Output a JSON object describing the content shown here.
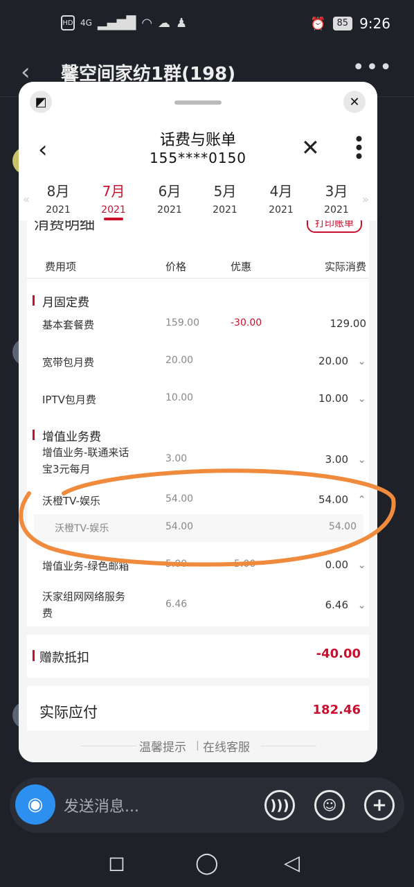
{
  "status_bar": {
    "left_icons": [
      "HD",
      "4G"
    ],
    "battery": "85",
    "time": "9:26"
  },
  "chat": {
    "title": "馨空间家纺1群(198)",
    "input_placeholder": "发送消息..."
  },
  "page": {
    "title": "话费与账单",
    "phone": "155****0150",
    "months": [
      {
        "month": "8月",
        "year": "2021",
        "active": false
      },
      {
        "month": "7月",
        "year": "2021",
        "active": true
      },
      {
        "month": "6月",
        "year": "2021",
        "active": false
      },
      {
        "month": "5月",
        "year": "2021",
        "active": false
      },
      {
        "month": "4月",
        "year": "2021",
        "active": false
      },
      {
        "month": "3月",
        "year": "2021",
        "active": false
      }
    ]
  },
  "bill": {
    "section_title": "消费明细",
    "print_label": "打印账单",
    "headers": {
      "item": "费用项",
      "price": "价格",
      "discount": "优惠",
      "actual": "实际消费"
    },
    "groups": [
      {
        "name": "月固定费",
        "rows": [
          {
            "item": "基本套餐费",
            "price": "159.00",
            "discount": "-30.00",
            "actual": "129.00"
          },
          {
            "item": "宽带包月费",
            "price": "20.00",
            "discount": "",
            "actual": "20.00"
          },
          {
            "item": "IPTV包月费",
            "price": "10.00",
            "discount": "",
            "actual": "10.00"
          }
        ]
      },
      {
        "name": "增值业务费",
        "rows": [
          {
            "item": "增值业务-联通来话宝3元每月",
            "item_line1": "增值业务-联通来话",
            "item_line2": "宝3元每月",
            "price": "3.00",
            "discount": "",
            "actual": "3.00"
          },
          {
            "item": "沃橙TV-娱乐",
            "price": "54.00",
            "discount": "",
            "actual": "54.00",
            "sub": {
              "item": "沃橙TV-娱乐",
              "price": "54.00",
              "actual": "54.00"
            }
          },
          {
            "item": "增值业务-绿色邮箱",
            "price": "5.00",
            "discount": "-5.00",
            "actual": "0.00"
          },
          {
            "item": "沃家组网网络服务费",
            "item_line1": "沃家组网网络服务",
            "item_line2": "费",
            "price": "6.46",
            "discount": "",
            "actual": "6.46"
          }
        ]
      }
    ],
    "donation": {
      "label": "赠款抵扣",
      "value": "-40.00"
    },
    "payable": {
      "label": "实际应付",
      "value": "182.46"
    },
    "footer": {
      "tips": "温馨提示",
      "service": "在线客服"
    }
  },
  "colors": {
    "accent": "#c8102e",
    "annotation": "#f08a3c",
    "camera": "#2d8ff0"
  }
}
